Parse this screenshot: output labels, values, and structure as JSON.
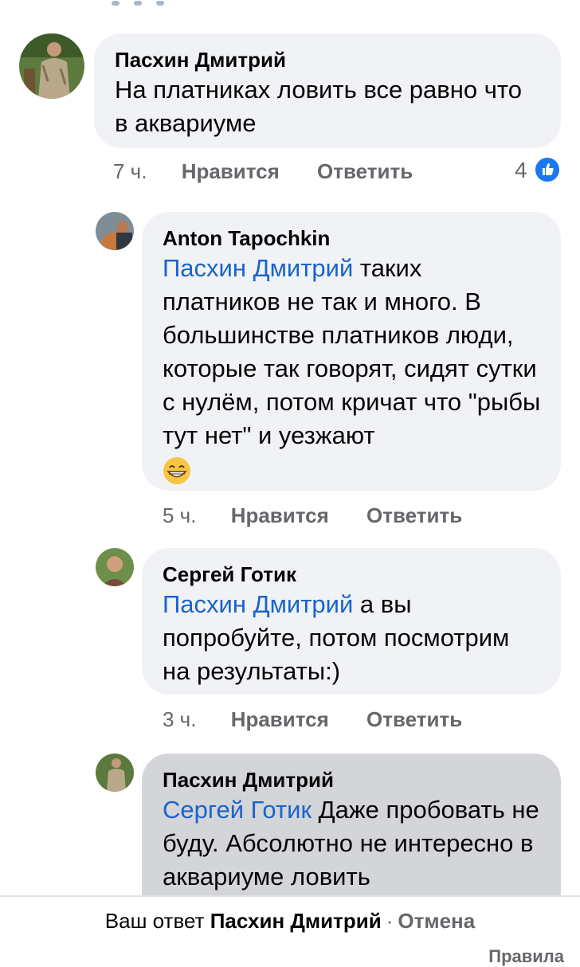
{
  "comments": [
    {
      "author": "Пасхин Дмитрий",
      "mention": "",
      "text": "На платниках ловить все равно что в аквариуме",
      "time": "7 ч.",
      "like_label": "Нравится",
      "reply_label": "Ответить",
      "reaction_count": "4"
    },
    {
      "author": "Anton Tapochkin",
      "mention": "Пасхин Дмитрий",
      "text": "таких платников не так и много. В большинстве платников люди, которые так говорят, сидят сутки с нулём, потом кричат что \"рыбы тут нет\" и уезжают",
      "emoji": "grinning-face-with-smiling-eyes-emoji",
      "time": "5 ч.",
      "like_label": "Нравится",
      "reply_label": "Ответить"
    },
    {
      "author": "Сергей Готик",
      "mention": "Пасхин Дмитрий",
      "text": "а вы попробуйте, потом посмотрим на результаты:)",
      "time": "3 ч.",
      "like_label": "Нравится",
      "reply_label": "Ответить"
    },
    {
      "author": "Пасхин Дмитрий",
      "mention": "Сергей Готик",
      "text": "Даже пробовать не буду. Абсолютно не интересно в аквариуме ловить"
    }
  ],
  "reply_bar": {
    "prefix": "Ваш ответ",
    "name": "Пасхин Дмитрий",
    "separator": "·",
    "cancel": "Отмена",
    "rules": "Правила"
  },
  "colors": {
    "mention": "#1a64c9",
    "bubble": "#f0f2f5",
    "bubble_selected": "#d3d5d9",
    "like_badge": "#1877f2",
    "meta": "#65676b"
  }
}
